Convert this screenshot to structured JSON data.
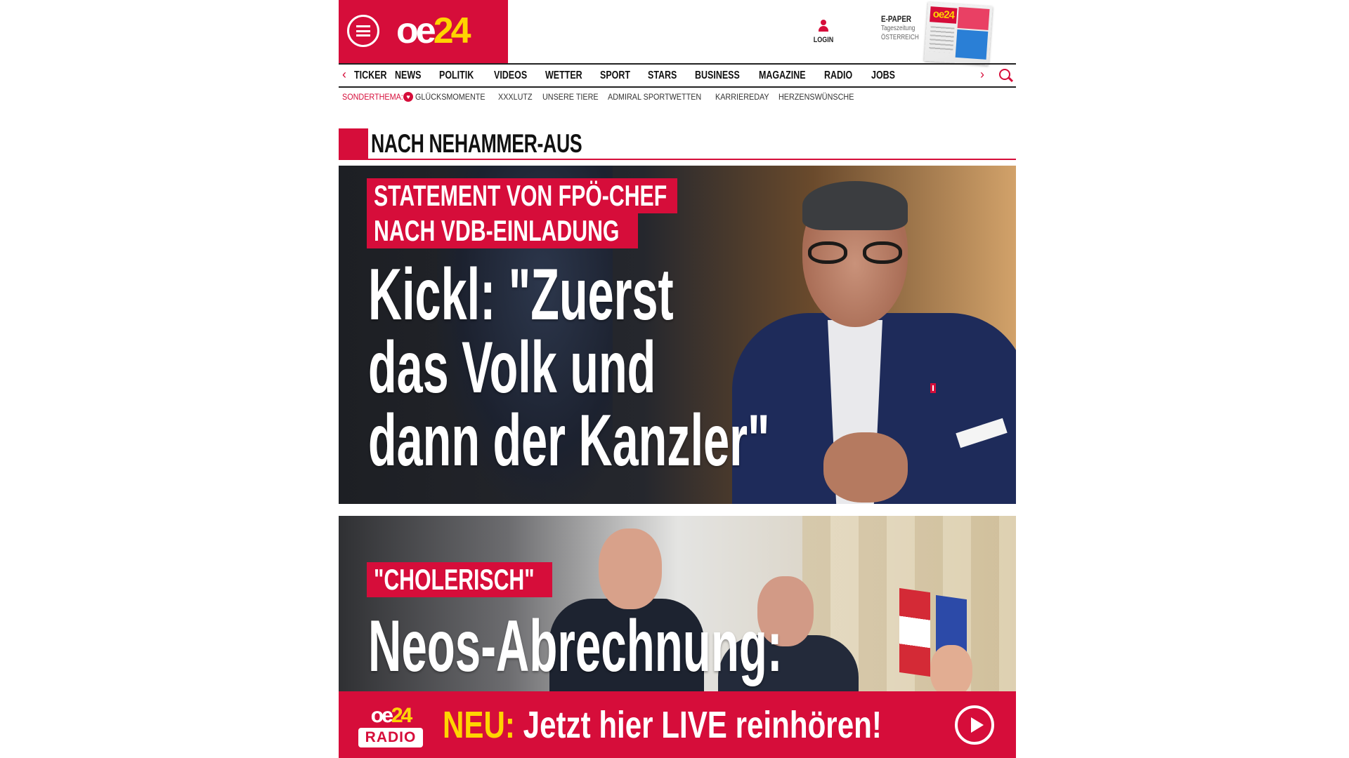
{
  "header": {
    "logo_oe": "oe",
    "logo_24": "24",
    "login_label": "LOGIN",
    "epaper_title": "E-PAPER",
    "epaper_sub1": "Tageszeitung",
    "epaper_sub2": "ÖSTERREICH",
    "epaper_cover_mast": "oe24"
  },
  "nav": {
    "prev_arrow": "‹",
    "next_arrow": "›",
    "items": [
      "TICKER",
      "NEWS",
      "POLITIK",
      "VIDEOS",
      "WETTER",
      "SPORT",
      "STARS",
      "BUSINESS",
      "MAGAZINE",
      "RADIO",
      "JOBS"
    ]
  },
  "topics": {
    "label": "SONDERTHEMA:",
    "items": [
      "GLÜCKSMOMENTE",
      "XXXLUTZ",
      "UNSERE TIERE",
      "ADMIRAL SPORTWETTEN",
      "KARRIEREDAY",
      "HERZENSWÜNSCHE"
    ]
  },
  "section": {
    "title": "NACH NEHAMMER-AUS"
  },
  "teaser1": {
    "kicker_line1": "STATEMENT VON FPÖ-CHEF",
    "kicker_line2": "NACH VDB-EINLADUNG",
    "headline_line1": "Kickl: \"Zuerst",
    "headline_line2": "das Volk und",
    "headline_line3": "dann der Kanzler\""
  },
  "teaser2": {
    "kicker": "\"CHOLERISCH\"",
    "headline": "Neos-Abrechnung:"
  },
  "radio_banner": {
    "logo_oe": "oe",
    "logo_24": "24",
    "logo_word": "RADIO",
    "neu": "NEU:",
    "text": " Jetzt hier LIVE reinhören!"
  },
  "colors": {
    "brand_red": "#d60d3a",
    "brand_yellow": "#ffd400"
  }
}
